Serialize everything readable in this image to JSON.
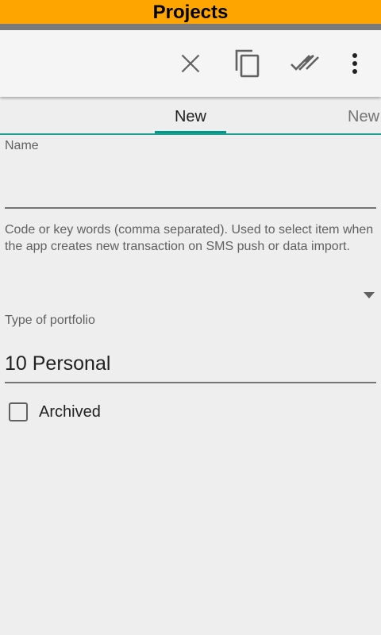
{
  "app": {
    "title": "Projects",
    "accent_color": "#ffa500",
    "tab_indicator_color": "#009688"
  },
  "toolbar": {
    "actions": [
      {
        "icon": "close-icon",
        "label": "Cancel"
      },
      {
        "icon": "copy-icon",
        "label": "Copy"
      },
      {
        "icon": "done-all-icon",
        "label": "Save"
      },
      {
        "icon": "more-vert-icon",
        "label": "More options"
      }
    ]
  },
  "tabs": [
    {
      "label": "New",
      "active": true
    },
    {
      "label": "New",
      "active": false
    }
  ],
  "form": {
    "name": {
      "label": "Name",
      "value": ""
    },
    "keywords": {
      "hint": "Code or key words (comma separated). Used to select item when the app creates new transaction on SMS push or data import.",
      "value": ""
    },
    "portfolio_type": {
      "label": "Type of portfolio",
      "value": "10 Personal"
    },
    "archived": {
      "label": "Archived",
      "checked": false
    }
  }
}
